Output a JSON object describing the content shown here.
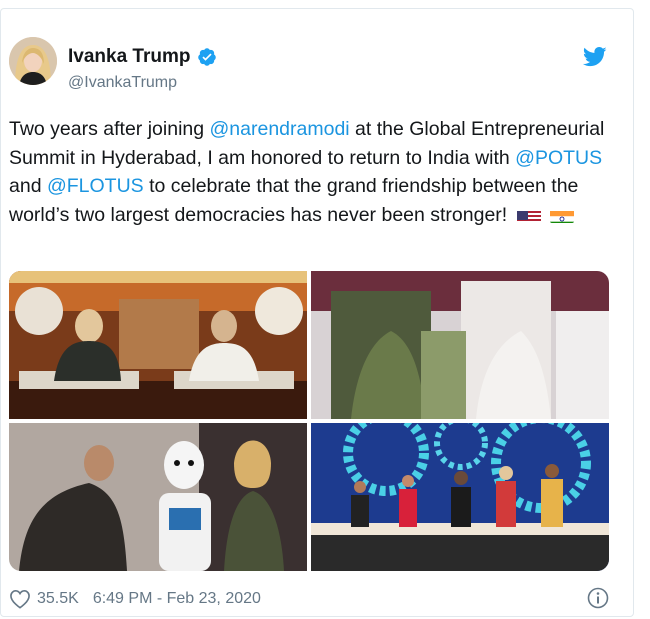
{
  "author": {
    "name": "Ivanka Trump",
    "handle": "@IvankaTrump"
  },
  "tweet": {
    "parts": [
      {
        "text": "Two years after joining ",
        "mention": false
      },
      {
        "text": "@narendramodi",
        "mention": true
      },
      {
        "text": " at the Global Entrepreneurial Summit in Hyderabad, I am honored to return to India with ",
        "mention": false
      },
      {
        "text": "@POTUS",
        "mention": true
      },
      {
        "text": " and ",
        "mention": false
      },
      {
        "text": "@FLOTUS",
        "mention": true
      },
      {
        "text": " to celebrate that the grand friendship between the world’s two largest democracies has never been stronger!",
        "mention": false
      }
    ]
  },
  "media": {
    "photo_count": 4
  },
  "footer": {
    "likes": "35.5K",
    "timestamp": "6:49 PM - Feb 23, 2020"
  },
  "colors": {
    "link": "#1b95e0",
    "muted": "#657786",
    "text": "#14171a",
    "verified": "#1da1f2"
  }
}
